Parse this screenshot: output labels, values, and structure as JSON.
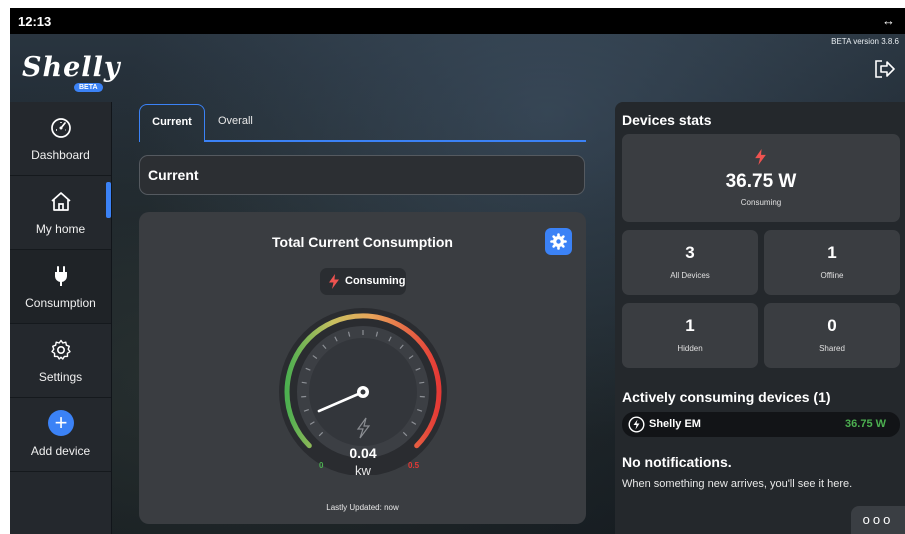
{
  "status_bar": {
    "time": "12:13",
    "resize_icon": "left-right-arrow-icon"
  },
  "app": {
    "logo_text": "Shelly",
    "logo_badge": "BETA",
    "version": "BETA version 3.8.6"
  },
  "sidebar": {
    "items": [
      {
        "label": "Dashboard",
        "icon": "speedometer-icon"
      },
      {
        "label": "My home",
        "icon": "home-icon"
      },
      {
        "label": "Consumption",
        "icon": "plug-icon",
        "active": true
      },
      {
        "label": "Settings",
        "icon": "gear-icon"
      },
      {
        "label": "Add device",
        "icon": "plus-circle-icon"
      }
    ]
  },
  "tabs": [
    {
      "label": "Current",
      "active": true
    },
    {
      "label": "Overall"
    }
  ],
  "section_header": "Current",
  "consumption_card": {
    "title": "Total Current Consumption",
    "status_label": "Consuming",
    "value": "0.04",
    "unit": "kw",
    "gauge_min": "0",
    "gauge_max": "0.5",
    "gauge_level": 0.08,
    "updated": "Lastly Updated: now"
  },
  "stats": {
    "title": "Devices stats",
    "consuming_value": "36.75 W",
    "consuming_label": "Consuming",
    "all_devices": {
      "value": "3",
      "label": "All Devices"
    },
    "offline": {
      "value": "1",
      "label": "Offline"
    },
    "hidden": {
      "value": "1",
      "label": "Hidden"
    },
    "shared": {
      "value": "0",
      "label": "Shared"
    }
  },
  "active": {
    "title": "Actively consuming devices (1)",
    "devices": [
      {
        "name": "Shelly EM",
        "power": "36.75 W"
      }
    ]
  },
  "notifications": {
    "title": "No notifications.",
    "text": "When something new arrives, you'll see it here."
  },
  "more_button": "ooo",
  "colors": {
    "accent": "#3b82f6",
    "green": "#4caf50",
    "red": "#e53935"
  }
}
